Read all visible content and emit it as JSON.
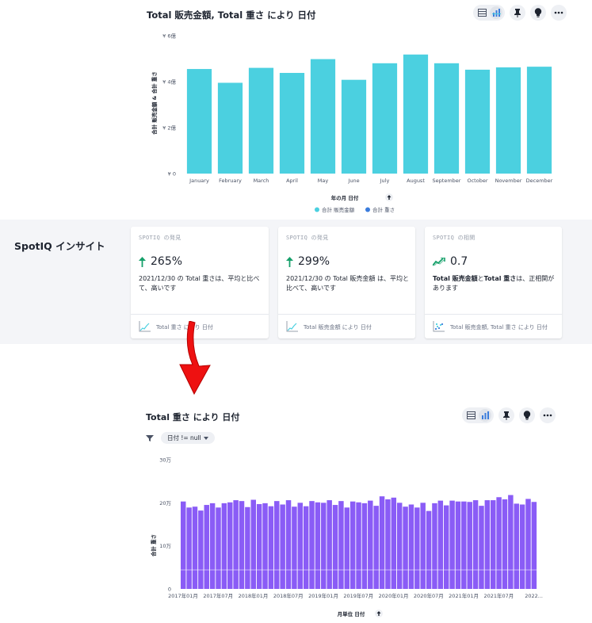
{
  "top_chart": {
    "title": "Total 販売金額, Total 重さ により 日付",
    "sort_icon": "arrow-up-icon",
    "chart_data": {
      "type": "bar",
      "categories": [
        "January",
        "February",
        "March",
        "April",
        "May",
        "June",
        "July",
        "August",
        "September",
        "October",
        "November",
        "December"
      ],
      "series": [
        {
          "name": "合計 販売金額",
          "values": [
            4.55,
            3.95,
            4.6,
            4.38,
            4.98,
            4.08,
            4.8,
            5.18,
            4.8,
            4.52,
            4.62,
            4.65
          ]
        }
      ],
      "yticks": [
        {
          "value": 0,
          "label": "¥ 0"
        },
        {
          "value": 2,
          "label": "¥ 2億"
        },
        {
          "value": 4,
          "label": "¥ 4億"
        },
        {
          "value": 6,
          "label": "¥ 6億"
        }
      ],
      "ylim": [
        0,
        6
      ],
      "xlabel": "年の月 日付",
      "ylabel": "合計 販売金額 & 合計 重さ",
      "legend": [
        {
          "label": "合計 販売金額",
          "color": "#4bd0e0"
        },
        {
          "label": "合計 重さ",
          "color": "#3b7ddd"
        }
      ],
      "legend_position": "bottom",
      "grid": false
    }
  },
  "spotiq": {
    "title": "SpotIQ インサイト",
    "cards": [
      {
        "kind": "SPOTIQ の発見",
        "value": "265%",
        "trend_icon": "arrow-up-icon",
        "desc": "2021/12/30 の Total 重さは、平均と比べて、高いです",
        "foot_icon": "line-chart-icon",
        "foot": "Total 重さ により 日付"
      },
      {
        "kind": "SPOTIQ の発見",
        "value": "299%",
        "trend_icon": "arrow-up-icon",
        "desc": "2021/12/30 の Total 販売金額 は、平均と比べて、高いです",
        "foot_icon": "line-chart-icon",
        "foot": "Total 販売金額 により 日付"
      },
      {
        "kind": "SPOTIQ の相関",
        "value": "0.7",
        "trend_icon": "trend-icon",
        "desc_parts": [
          "Total 販売金額",
          "と",
          "Total 重さ",
          "は、正相関があります"
        ],
        "foot_icon": "scatter-icon",
        "foot": "Total 販売金額, Total 重さ により 日付"
      }
    ]
  },
  "annotation": {
    "arrow_color": "#ee1111",
    "arrow_icon": "arrow-down-icon"
  },
  "bottom_chart": {
    "title": "Total 重さ により 日付",
    "filter_label": "日付 != null",
    "sort_icon": "arrow-up-icon",
    "chart_data": {
      "type": "bar",
      "values": [
        20.3,
        18.9,
        19.1,
        18.2,
        19.5,
        19.9,
        18.9,
        19.9,
        20.1,
        20.6,
        20.4,
        19.0,
        20.7,
        19.7,
        19.9,
        19.2,
        20.4,
        19.6,
        20.6,
        19.1,
        20.0,
        19.2,
        20.4,
        20.1,
        20.0,
        20.6,
        19.5,
        20.4,
        18.9,
        20.3,
        20.1,
        19.9,
        20.5,
        19.3,
        21.5,
        20.8,
        21.2,
        20.0,
        19.1,
        19.6,
        18.9,
        20.0,
        18.1,
        19.9,
        20.5,
        19.4,
        20.5,
        20.3,
        20.3,
        20.2,
        20.6,
        19.3,
        20.6,
        20.6,
        21.3,
        20.8,
        21.8,
        19.8,
        19.6,
        20.9,
        20.2
      ],
      "xticks": [
        "2017年01月",
        "2017年07月",
        "2018年01月",
        "2018年07月",
        "2019年01月",
        "2019年07月",
        "2020年01月",
        "2020年07月",
        "2021年01月",
        "2021年07月",
        "2022..."
      ],
      "yticks": [
        {
          "value": 0,
          "label": "0"
        },
        {
          "value": 10,
          "label": "10万"
        },
        {
          "value": 20,
          "label": "20万"
        },
        {
          "value": 30,
          "label": "30万"
        }
      ],
      "ylim": [
        0,
        30
      ],
      "xlabel": "月単位 日付",
      "ylabel": "合計 重さ",
      "color": "#8a5cf6"
    }
  },
  "icons": {
    "table": "table-icon",
    "chart": "bar-chart-icon",
    "pin": "pin-icon",
    "insight": "lightbulb-icon",
    "more": "more-icon",
    "filter": "filter-icon",
    "chip_caret": "caret-down-icon"
  }
}
